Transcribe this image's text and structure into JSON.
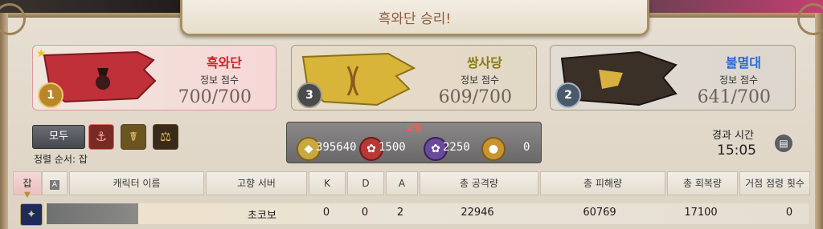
{
  "window": {
    "title": "흑와단 승리!"
  },
  "teams": [
    {
      "name": "흑와단",
      "name_color": "#d0202a",
      "score_label": "정보 점수",
      "score": "700/700",
      "rank": "1",
      "rank_color": "#b9862c",
      "winner": true,
      "flag_color": "#c03038"
    },
    {
      "name": "쌍사당",
      "name_color": "#8a7a10",
      "score_label": "정보 점수",
      "score": "609/700",
      "rank": "3",
      "rank_color": "#4a4a4a",
      "winner": false,
      "flag_color": "#d8b438"
    },
    {
      "name": "불멸대",
      "name_color": "#2a6ad0",
      "score_label": "정보 점수",
      "score": "641/700",
      "rank": "2",
      "rank_color": "#4a5a6a",
      "winner": false,
      "flag_color": "#3a3028"
    }
  ],
  "filters": {
    "all_label": "모두",
    "sort_label": "정렬 순서: 잡",
    "icons": [
      "maelstrom-filter-icon",
      "twin-adder-filter-icon",
      "immortal-flames-filter-icon"
    ]
  },
  "rewards": {
    "title": "보상",
    "items": [
      {
        "icon": "pvp-exp-icon",
        "value": "395640",
        "color": "#c8a840"
      },
      {
        "icon": "wolf-mark-icon",
        "value": "1500",
        "color": "#b83838"
      },
      {
        "icon": "trophy-crystal-icon",
        "value": "2250",
        "color": "#6a4a9a"
      },
      {
        "icon": "achievement-medal-icon",
        "value": "0",
        "color": "#c89430"
      }
    ]
  },
  "elapsed": {
    "label": "경과 시간",
    "value": "15:05"
  },
  "table": {
    "headers": [
      "잡",
      "A",
      "캐릭터 이름",
      "고향 서버",
      "K",
      "D",
      "A",
      "총 공격량",
      "총 피해량",
      "총 회복량",
      "거점 점령 횟수"
    ],
    "rows": [
      {
        "job_icon": "paladin-job-icon",
        "name": "",
        "server": "초코보",
        "k": "0",
        "d": "0",
        "a": "2",
        "damage_dealt": "22946",
        "damage_taken": "60769",
        "healing": "17100",
        "captures": "0"
      }
    ]
  }
}
